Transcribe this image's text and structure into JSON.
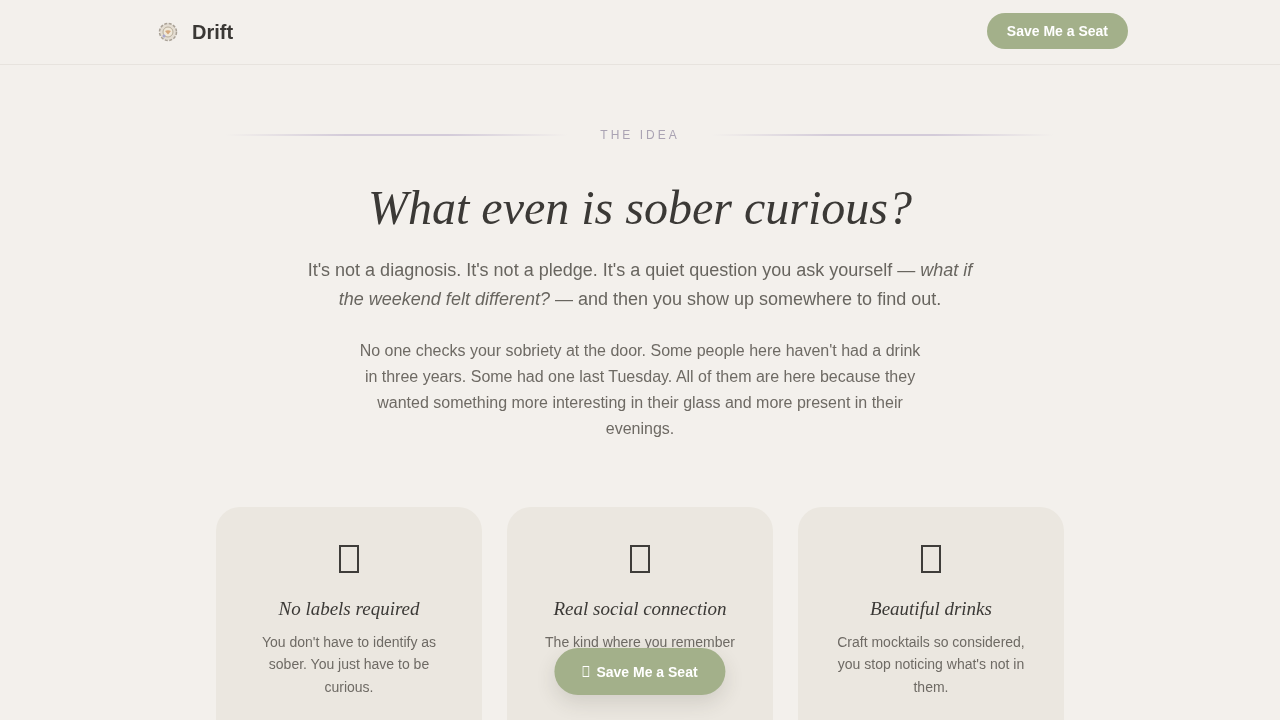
{
  "header": {
    "logo": "Drift",
    "button": "Save Me a Seat"
  },
  "section": {
    "eyebrow": "THE IDEA",
    "heading": "What even is sober curious?",
    "lead": "It's not a diagnosis. It's not a pledge. It's a quiet question you ask yourself — *what if the weekend felt different?* — and then you show up somewhere to find out.",
    "body": "No one checks your sobriety at the door. Some people here haven't had a drink in three years. Some had one last Tuesday. All of them are here because they wanted something more interesting in their glass and more present in their evenings."
  },
  "cards": [
    {
      "title": "No labels required",
      "text": "You don't have to identify as sober. You just have to be curious."
    },
    {
      "title": "Real social connection",
      "text": "The kind where you remember"
    },
    {
      "title": "Beautiful drinks",
      "text": "Craft mocktails so considered, you stop noticing what's not in them."
    }
  ],
  "floating_button": {
    "label": "Save Me a Seat"
  }
}
